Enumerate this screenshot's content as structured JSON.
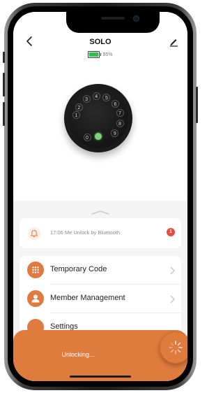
{
  "header": {
    "title": "SOLO",
    "battery_text": "95%",
    "battery_level": 0.95
  },
  "lock": {
    "keys": [
      "1",
      "2",
      "3",
      "4",
      "5",
      "6",
      "7",
      "8",
      "9",
      "0"
    ]
  },
  "notice": {
    "text": "17:06 Me  Unlock by Bluetooth",
    "badge": "1"
  },
  "menu": {
    "items": [
      {
        "label": "Temporary Code"
      },
      {
        "label": "Member Management"
      },
      {
        "label": "Settings"
      }
    ]
  },
  "overlay": {
    "status": "Unlocking..."
  },
  "colors": {
    "accent": "#e07b3e",
    "badge": "#e84b3c",
    "battery": "#2fbf4a"
  }
}
